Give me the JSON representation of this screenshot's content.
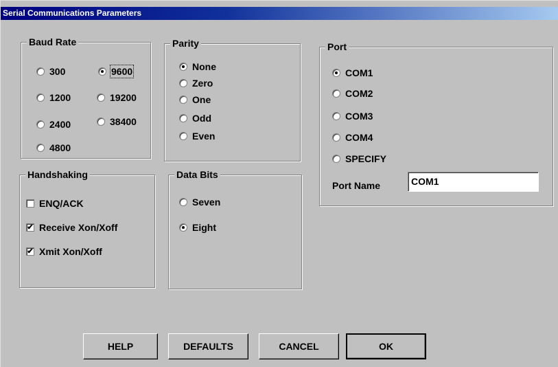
{
  "window": {
    "title": "Serial Communications Parameters"
  },
  "baud_rate": {
    "legend": "Baud Rate",
    "options": [
      {
        "label": "300",
        "selected": false
      },
      {
        "label": "9600",
        "selected": true
      },
      {
        "label": "1200",
        "selected": false
      },
      {
        "label": "19200",
        "selected": false
      },
      {
        "label": "2400",
        "selected": false
      },
      {
        "label": "38400",
        "selected": false
      },
      {
        "label": "4800",
        "selected": false
      }
    ]
  },
  "parity": {
    "legend": "Parity",
    "options": [
      {
        "label": "None",
        "selected": true
      },
      {
        "label": "Zero",
        "selected": false
      },
      {
        "label": "One",
        "selected": false
      },
      {
        "label": "Odd",
        "selected": false
      },
      {
        "label": "Even",
        "selected": false
      }
    ]
  },
  "port": {
    "legend": "Port",
    "options": [
      {
        "label": "COM1",
        "selected": true
      },
      {
        "label": "COM2",
        "selected": false
      },
      {
        "label": "COM3",
        "selected": false
      },
      {
        "label": "COM4",
        "selected": false
      },
      {
        "label": "SPECIFY",
        "selected": false
      }
    ],
    "port_name_label": "Port Name",
    "port_name_value": "COM1"
  },
  "handshaking": {
    "legend": "Handshaking",
    "options": [
      {
        "label": "ENQ/ACK",
        "checked": false
      },
      {
        "label": "Receive Xon/Xoff",
        "checked": true
      },
      {
        "label": "Xmit Xon/Xoff",
        "checked": true
      }
    ]
  },
  "data_bits": {
    "legend": "Data Bits",
    "options": [
      {
        "label": "Seven",
        "selected": false
      },
      {
        "label": "Eight",
        "selected": true
      }
    ]
  },
  "buttons": {
    "help": "HELP",
    "defaults": "DEFAULTS",
    "cancel": "CANCEL",
    "ok": "OK"
  }
}
